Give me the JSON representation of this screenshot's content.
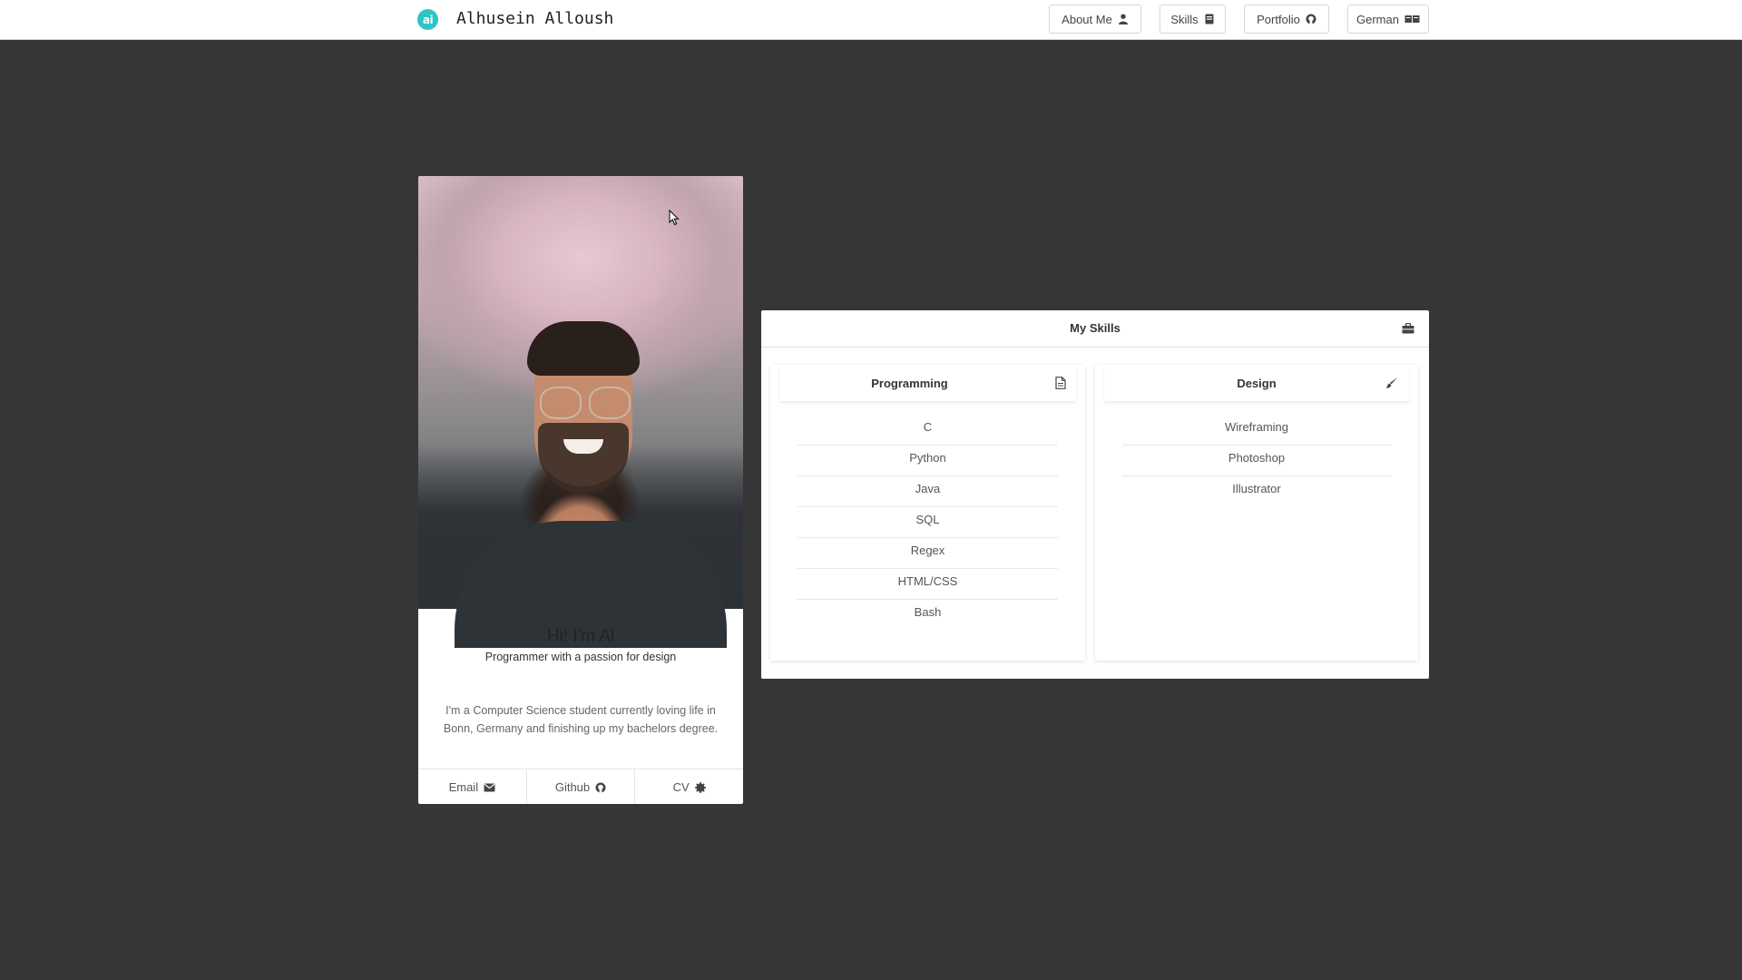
{
  "header": {
    "logo_text": "ai",
    "brand_name": "Alhusein Alloush",
    "nav": [
      {
        "label": "About Me",
        "icon": "user-icon"
      },
      {
        "label": "Skills",
        "icon": "book-icon"
      },
      {
        "label": "Portfolio",
        "icon": "github-icon"
      },
      {
        "label": "German",
        "icon": "language-icon"
      }
    ]
  },
  "profile": {
    "photo_alt": "profile-photo",
    "greeting": "Hi! I'm Al",
    "tagline": "Programmer with a passion for design",
    "bio": "I'm a Computer Science student currently loving life in Bonn, Germany and finishing up my bachelors degree.",
    "links": [
      {
        "label": "Email",
        "icon": "envelope-icon"
      },
      {
        "label": "Github",
        "icon": "github-icon"
      },
      {
        "label": "CV",
        "icon": "gear-badge-icon"
      }
    ]
  },
  "skills": {
    "title": "My Skills",
    "icon": "briefcase-icon",
    "programming": {
      "title": "Programming",
      "icon": "document-icon",
      "items": [
        "C",
        "Python",
        "Java",
        "SQL",
        "Regex",
        "HTML/CSS",
        "Bash"
      ]
    },
    "design": {
      "title": "Design",
      "icon": "paintbrush-icon",
      "items": [
        "Wireframing",
        "Photoshop",
        "Illustrator"
      ]
    }
  },
  "colors": {
    "page_background": "#363636",
    "logo_accent": "#2ec4c6",
    "card_background": "#ffffff"
  }
}
